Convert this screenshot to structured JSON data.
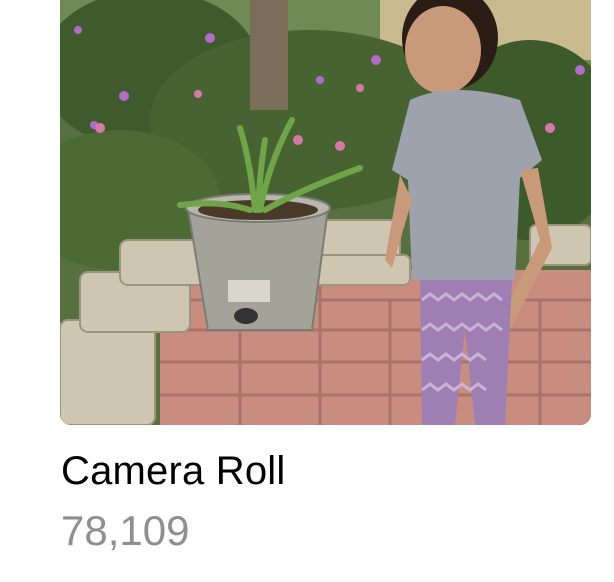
{
  "album": {
    "title": "Camera Roll",
    "count": "78,109",
    "thumbnail_alt": "Toddler standing on a brick patio beside a potted plant and flowering shrubs"
  },
  "colors": {
    "title_text": "#000000",
    "count_text": "#8e8e93",
    "background": "#ffffff"
  }
}
